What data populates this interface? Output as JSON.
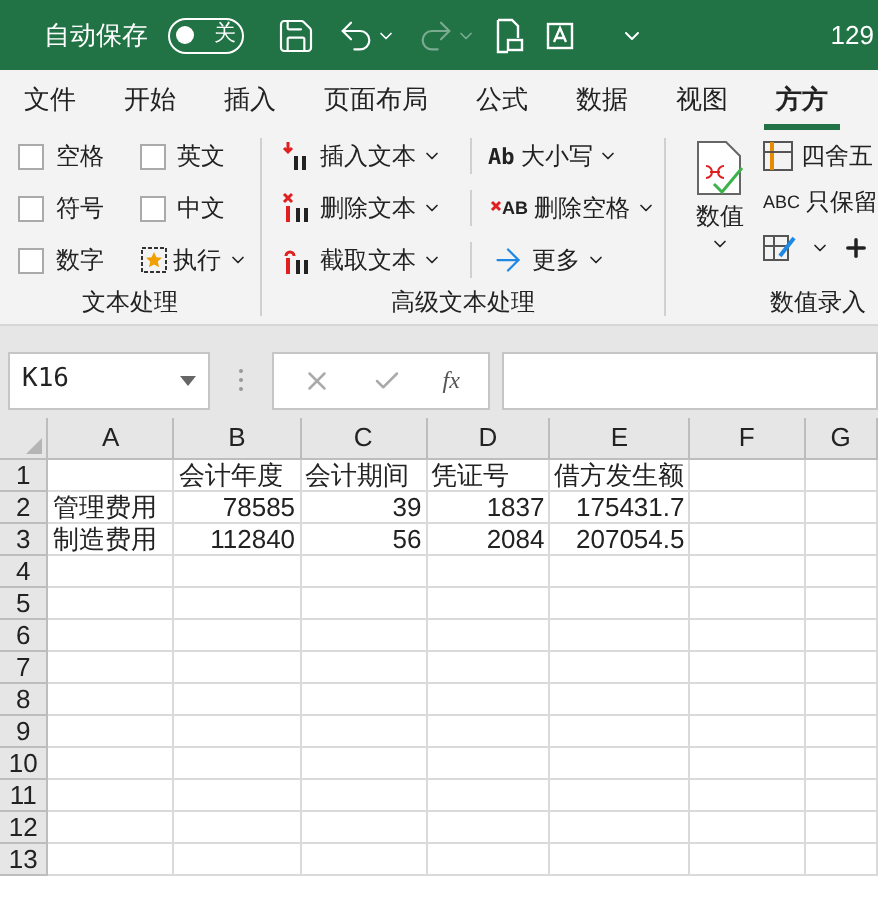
{
  "title_bar": {
    "autosave_label": "自动保存",
    "autosave_toggle": {
      "on": false,
      "text": "关"
    },
    "title": "129"
  },
  "tabs": [
    {
      "label": "文件",
      "selected": false
    },
    {
      "label": "开始",
      "selected": false
    },
    {
      "label": "插入",
      "selected": false
    },
    {
      "label": "页面布局",
      "selected": false
    },
    {
      "label": "公式",
      "selected": false
    },
    {
      "label": "数据",
      "selected": false
    },
    {
      "label": "视图",
      "selected": false
    },
    {
      "label": "方方",
      "selected": true
    }
  ],
  "ribbon": {
    "groups": [
      {
        "label": "文本处理",
        "checkboxes": [
          {
            "label": "空格",
            "checked": false
          },
          {
            "label": "英文",
            "checked": false
          },
          {
            "label": "符号",
            "checked": false
          },
          {
            "label": "中文",
            "checked": false
          },
          {
            "label": "数字",
            "checked": false
          }
        ],
        "run_button": "执行"
      },
      {
        "label": "高级文本处理",
        "buttons": [
          {
            "label": "插入文本",
            "kind": "insert"
          },
          {
            "label": "删除文本",
            "kind": "delete"
          },
          {
            "label": "截取文本",
            "kind": "cut"
          },
          {
            "label": "大小写",
            "kind": "case",
            "icon_text": "Ab"
          },
          {
            "label": "删除空格",
            "kind": "space",
            "icon_text": "AB"
          },
          {
            "label": "更多",
            "kind": "more"
          }
        ]
      },
      {
        "label": "数值录入",
        "big_button": "数值",
        "small_buttons": [
          {
            "label": "四舍五",
            "kind": "round"
          },
          {
            "label": "只保留",
            "kind": "keep",
            "icon_text": "ABC"
          }
        ]
      }
    ]
  },
  "formula_bar": {
    "name_box": "K16",
    "fx": "fx"
  },
  "sheet": {
    "columns": [
      "A",
      "B",
      "C",
      "D",
      "E",
      "F",
      "G"
    ],
    "rows": [
      {
        "header": "1",
        "cells": [
          "",
          "会计年度",
          "会计期间",
          "凭证号",
          "借方发生额",
          "",
          ""
        ]
      },
      {
        "header": "2",
        "cells": [
          "管理费用",
          "78585",
          "39",
          "1837",
          "175431.7",
          "",
          ""
        ]
      },
      {
        "header": "3",
        "cells": [
          "制造费用",
          "112840",
          "56",
          "2084",
          "207054.5",
          "",
          ""
        ]
      },
      {
        "header": "4",
        "cells": []
      },
      {
        "header": "5",
        "cells": []
      },
      {
        "header": "6",
        "cells": []
      },
      {
        "header": "7",
        "cells": []
      },
      {
        "header": "8",
        "cells": []
      },
      {
        "header": "9",
        "cells": []
      },
      {
        "header": "10",
        "cells": []
      },
      {
        "header": "11",
        "cells": []
      },
      {
        "header": "12",
        "cells": []
      },
      {
        "header": "13",
        "cells": []
      }
    ]
  }
}
